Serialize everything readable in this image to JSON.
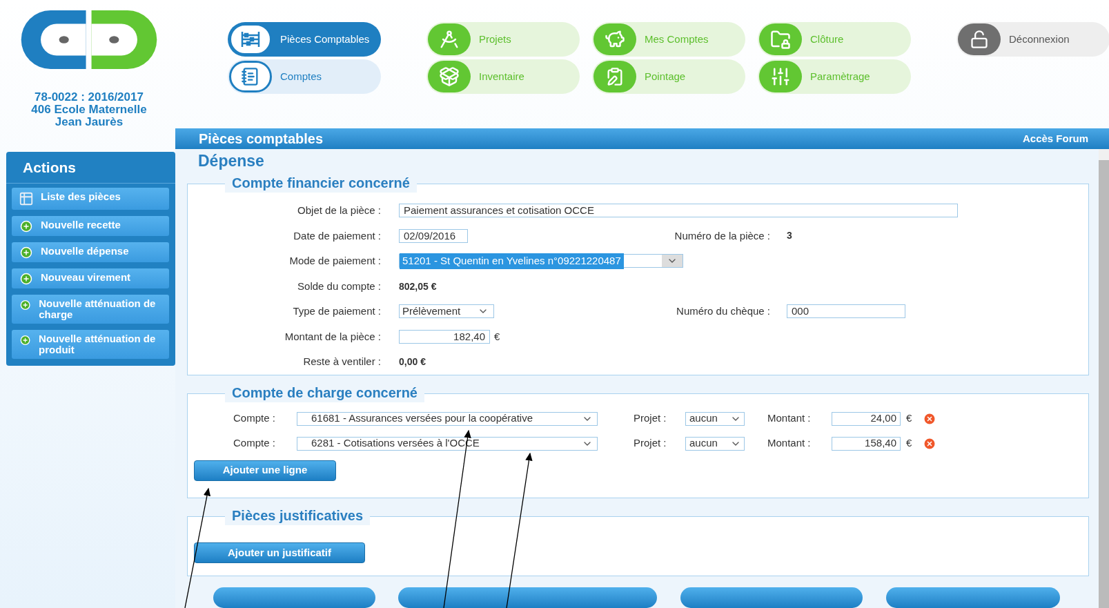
{
  "school_info": [
    "78-0022 : 2016/2017",
    "406 Ecole Maternelle",
    "Jean Jaurès"
  ],
  "nav": [
    {
      "label": "Pièces Comptables",
      "kind": "blue",
      "selected": true
    },
    {
      "label": "Comptes",
      "kind": "blue",
      "selected": false
    },
    {
      "label": "Projets",
      "kind": "green",
      "selected": false
    },
    {
      "label": "Inventaire",
      "kind": "green",
      "selected": false
    },
    {
      "label": "Mes Comptes",
      "kind": "green",
      "selected": false
    },
    {
      "label": "Pointage",
      "kind": "green",
      "selected": false
    },
    {
      "label": "Clôture",
      "kind": "green",
      "selected": false
    },
    {
      "label": "Paramètrage",
      "kind": "green",
      "selected": false
    },
    {
      "label": "Déconnexion",
      "kind": "grey",
      "selected": false
    }
  ],
  "header": {
    "title": "Pièces comptables",
    "link": "Accès Forum"
  },
  "sidebar": {
    "title": "Actions",
    "items": [
      {
        "label": "Liste des pièces",
        "kind": "list"
      },
      {
        "label": "Nouvelle recette",
        "kind": "add"
      },
      {
        "label": "Nouvelle dépense",
        "kind": "add"
      },
      {
        "label": "Nouveau virement",
        "kind": "add"
      },
      {
        "label": "Nouvelle atténuation de charge",
        "kind": "add"
      },
      {
        "label": "Nouvelle atténuation de produit",
        "kind": "add"
      }
    ]
  },
  "form": {
    "title": "Dépense",
    "financial": {
      "title": "Compte financier concerné",
      "rows": [
        {
          "label": "Objet de la pièce :",
          "kind": "text",
          "value": "Paiement assurances et cotisation OCCE"
        },
        {
          "label": "Date de paiement :",
          "kind": "date",
          "value": "02/09/2016",
          "right": {
            "label": "Numéro de la pièce :",
            "kind": "static",
            "value": "3"
          }
        },
        {
          "label": "Mode de paiement :",
          "kind": "select",
          "value": "51201 - St Quentin en Yvelines n°09221220487",
          "highlighted": true
        },
        {
          "label": "Solde du compte :",
          "kind": "static",
          "value": "802,05 €"
        },
        {
          "label": "Type de paiement :",
          "kind": "select",
          "value": "Prélèvement",
          "highlighted": false,
          "right": {
            "label": "Numéro du chèque :",
            "kind": "text",
            "value": "000"
          }
        },
        {
          "label": "Montant de la pièce :",
          "kind": "amount",
          "value": "182,40",
          "unit": "€"
        },
        {
          "label": "Reste à ventiler :",
          "kind": "static",
          "value": "0,00 €"
        }
      ]
    },
    "charges": {
      "title": "Compte de charge concerné",
      "lines": [
        {
          "compte_label": "Compte :",
          "compte": "61681 - Assurances versées pour la coopérative",
          "projet_label": "Projet :",
          "projet": "aucun",
          "montant_label": "Montant :",
          "montant": "24,00",
          "unit": "€"
        },
        {
          "compte_label": "Compte :",
          "compte": "6281 - Cotisations versées à l'OCCE",
          "projet_label": "Projet :",
          "projet": "aucun",
          "montant_label": "Montant :",
          "montant": "158,40",
          "unit": "€"
        }
      ],
      "button": "Ajouter une ligne"
    },
    "attachments": {
      "title": "Pièces justificatives",
      "button": "Ajouter un justificatif"
    }
  }
}
